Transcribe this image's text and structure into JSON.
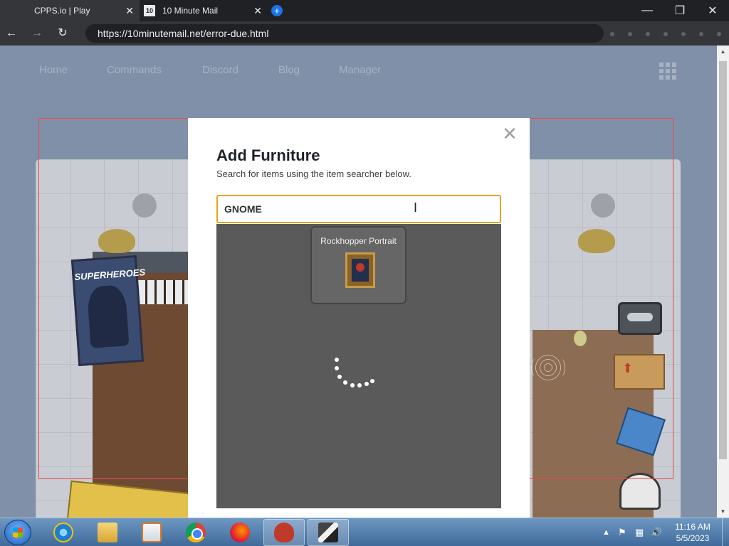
{
  "browser": {
    "tabs": [
      {
        "title": "CPPS.io | Play",
        "close": "✕"
      },
      {
        "title": "10 Minute Mail",
        "favicon_text": "10",
        "close": "✕"
      }
    ],
    "new_tab": "+",
    "window_controls": {
      "minimize": "—",
      "restore": "❐",
      "close": "✕"
    },
    "nav": {
      "back": "←",
      "forward": "→",
      "reload": "↻"
    },
    "url": "https://10minutemail.net/error-due.html"
  },
  "site_nav": [
    "Home",
    "Commands",
    "Discord",
    "Blog",
    "Manager"
  ],
  "game": {
    "poster_title": "SUPERHEROES"
  },
  "modal": {
    "close": "✕",
    "title": "Add Furniture",
    "subtitle": "Search for items using the item searcher below.",
    "search_value": "GNOME",
    "results": [
      {
        "name": "Rockhopper Portrait",
        "icon": "rockhopper-portrait-icon"
      }
    ],
    "loading": true
  },
  "scrollbar": {
    "up": "▲",
    "down": "▼"
  },
  "taskbar": {
    "apps": [
      "internet-explorer",
      "windows-explorer",
      "media-player",
      "google-chrome",
      "firefox",
      "cpps",
      "other-app"
    ],
    "active_apps": [
      "cpps",
      "other-app"
    ],
    "tray_arrow": "▲",
    "time": "11:16 AM",
    "date": "5/5/2023"
  },
  "colors": {
    "search_border": "#e8a317",
    "results_bg": "#5a5a5a",
    "overlay_frame": "#e74c4c"
  }
}
